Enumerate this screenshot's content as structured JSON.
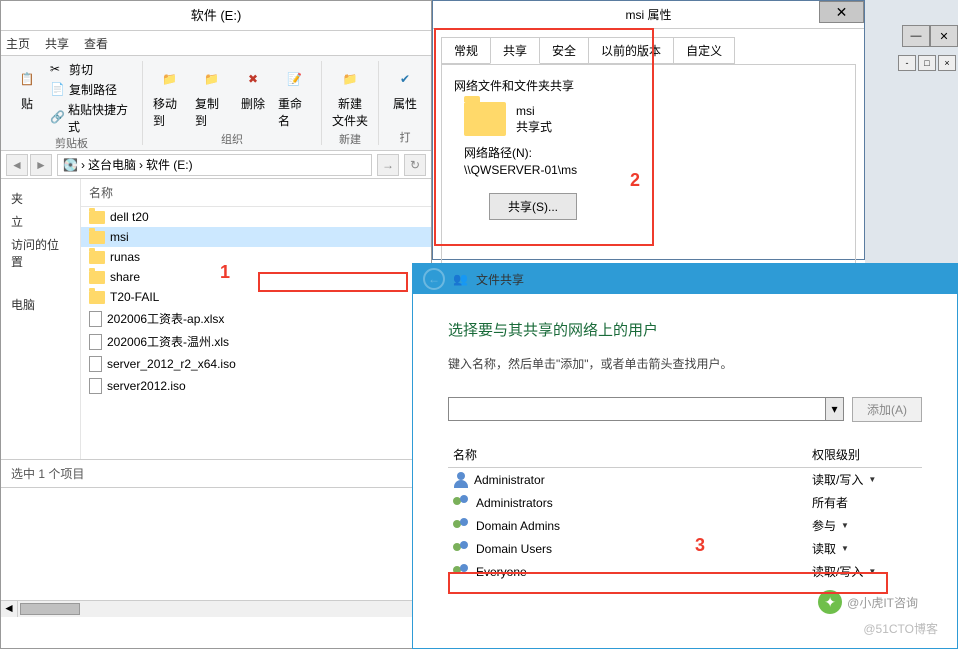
{
  "explorer": {
    "title": "软件 (E:)",
    "tabs": {
      "home": "主页",
      "share": "共享",
      "view": "查看"
    },
    "clipboard": {
      "cut": "剪切",
      "copy_path": "复制路径",
      "paste_shortcut": "粘贴快捷方式",
      "group": "剪贴板",
      "paste": "贴"
    },
    "organize": {
      "move": "移动到",
      "copy": "复制到",
      "delete": "删除",
      "rename": "重命名",
      "group": "组织"
    },
    "new": {
      "new_folder": "新建\n文件夹",
      "group": "新建"
    },
    "open": {
      "props": "属性",
      "group": "打"
    },
    "path": {
      "pc": "这台电脑",
      "drive": "软件 (E:)"
    },
    "nav": {
      "quick": "夹",
      "recent": "立",
      "places": "访问的位置",
      "pc": "电脑"
    },
    "col_name": "名称",
    "files": [
      {
        "name": "dell t20",
        "type": "folder"
      },
      {
        "name": "msi",
        "type": "folder",
        "selected": true
      },
      {
        "name": "runas",
        "type": "folder"
      },
      {
        "name": "share",
        "type": "folder"
      },
      {
        "name": "T20-FAIL",
        "type": "folder"
      },
      {
        "name": "202006工资表-ap.xlsx",
        "type": "file"
      },
      {
        "name": "202006工资表-温州.xls",
        "type": "file"
      },
      {
        "name": "server_2012_r2_x64.iso",
        "type": "file"
      },
      {
        "name": "server2012.iso",
        "type": "file"
      }
    ],
    "status": "选中 1 个项目"
  },
  "props": {
    "title": "msi 属性",
    "tabs": {
      "general": "常规",
      "share": "共享",
      "security": "安全",
      "prev": "以前的版本",
      "custom": "自定义"
    },
    "section": "网络文件和文件夹共享",
    "name": "msi",
    "state": "共享式",
    "path_label": "网络路径(N):",
    "path": "\\\\QWSERVER-01\\ms",
    "share_btn": "共享(S)..."
  },
  "share": {
    "title": "文件共享",
    "heading": "选择要与其共享的网络上的用户",
    "hint": "键入名称，然后单击\"添加\"，或者单击箭头查找用户。",
    "add": "添加(A)",
    "col_name": "名称",
    "col_perm": "权限级别",
    "users": [
      {
        "name": "Administrator",
        "perm": "读取/写入",
        "dd": true,
        "icon": "user"
      },
      {
        "name": "Administrators",
        "perm": "所有者",
        "dd": false,
        "icon": "group"
      },
      {
        "name": "Domain Admins",
        "perm": "参与",
        "dd": true,
        "icon": "group"
      },
      {
        "name": "Domain Users",
        "perm": "读取",
        "dd": true,
        "icon": "group"
      },
      {
        "name": "Everyone",
        "perm": "读取/写入",
        "dd": true,
        "icon": "group"
      }
    ]
  },
  "annotations": {
    "a1": "1",
    "a2": "2",
    "a3": "3"
  },
  "watermark": {
    "blog": "@小虎IT咨询",
    "site": "@51CTO博客"
  }
}
